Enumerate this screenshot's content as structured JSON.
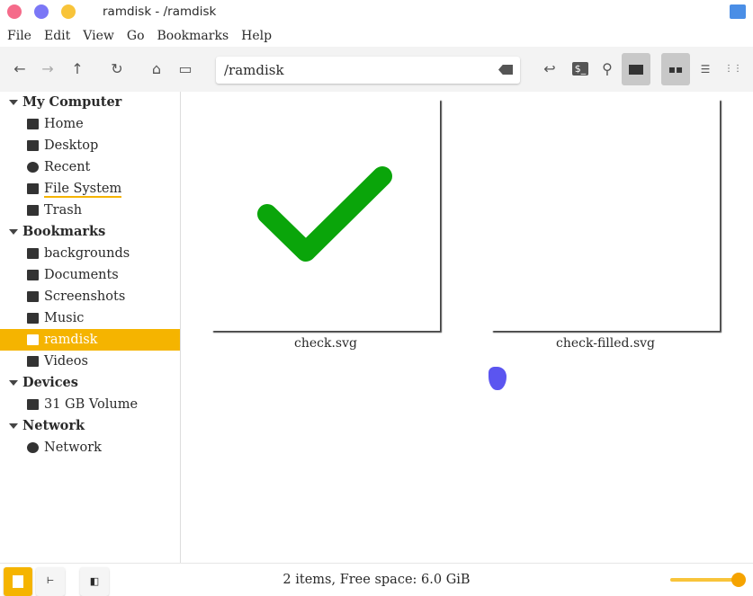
{
  "window": {
    "title": "ramdisk - /ramdisk",
    "controls": {
      "close": "#f56b8a",
      "minimize": "#7b77f6",
      "maximize": "#f8c43a"
    }
  },
  "menu": [
    "File",
    "Edit",
    "View",
    "Go",
    "Bookmarks",
    "Help"
  ],
  "toolbar": {
    "path": "/ramdisk",
    "icons": [
      "back-icon",
      "forward-icon",
      "up-icon",
      "reload-icon",
      "home-icon",
      "computer-icon",
      "clear-icon",
      "go-icon",
      "terminal-icon",
      "search-icon",
      "preview-icon",
      "icon-view-icon",
      "list-view-icon",
      "compact-view-icon"
    ]
  },
  "sidebar": [
    {
      "type": "head",
      "label": "My Computer"
    },
    {
      "type": "item",
      "label": "Home",
      "icon": "home-icon"
    },
    {
      "type": "item",
      "label": "Desktop",
      "icon": "desktop-icon"
    },
    {
      "type": "item",
      "label": "Recent",
      "icon": "recent-icon"
    },
    {
      "type": "item",
      "label": "File System",
      "icon": "drive-icon"
    },
    {
      "type": "item",
      "label": "Trash",
      "icon": "trash-icon"
    },
    {
      "type": "head",
      "label": "Bookmarks"
    },
    {
      "type": "item",
      "label": "backgrounds",
      "icon": "folder-icon"
    },
    {
      "type": "item",
      "label": "Documents",
      "icon": "document-icon"
    },
    {
      "type": "item",
      "label": "Screenshots",
      "icon": "folder-icon"
    },
    {
      "type": "item",
      "label": "Music",
      "icon": "music-icon"
    },
    {
      "type": "item",
      "label": "ramdisk",
      "icon": "folder-icon",
      "selected": true
    },
    {
      "type": "item",
      "label": "Videos",
      "icon": "video-icon"
    },
    {
      "type": "head",
      "label": "Devices"
    },
    {
      "type": "item",
      "label": "31 GB Volume",
      "icon": "usb-icon"
    },
    {
      "type": "head",
      "label": "Network"
    },
    {
      "type": "item",
      "label": "Network",
      "icon": "network-icon"
    }
  ],
  "files": [
    {
      "name": "check.svg"
    },
    {
      "name": "check-filled.svg"
    }
  ],
  "status": {
    "text": "2 items, Free space: 6.0 GiB",
    "zoom_level": 1.0,
    "accent": "#f5b400"
  }
}
